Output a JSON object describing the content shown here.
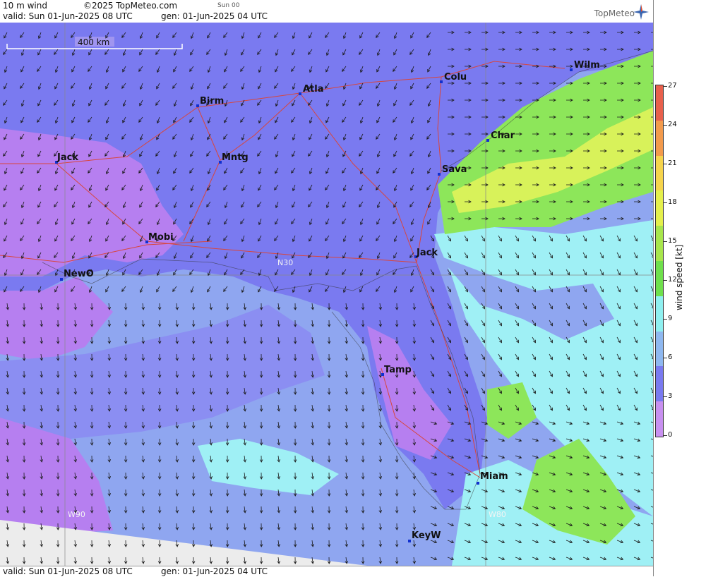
{
  "header": {
    "product": "10 m wind",
    "copyright": "©2025 TopMeteo.com",
    "run_tag": "Sun 00",
    "valid": "valid:  Sun  01-Jun-2025  08 UTC",
    "gen": "gen: 01-Jun-2025 04 UTC",
    "brand": "TopMeteo"
  },
  "footer": {
    "valid": "valid:  Sun  01-Jun-2025  08 UTC",
    "gen": "gen: 01-Jun-2025 04 UTC"
  },
  "scale_bar": {
    "label": "400 km"
  },
  "grid_labels": [
    "N30",
    "W90",
    "W80"
  ],
  "cities": [
    {
      "name": "Wilm"
    },
    {
      "name": "Colu"
    },
    {
      "name": "Atla"
    },
    {
      "name": "Birm"
    },
    {
      "name": "Char"
    },
    {
      "name": "Jack"
    },
    {
      "name": "Mntg"
    },
    {
      "name": "Sava"
    },
    {
      "name": "Mobi"
    },
    {
      "name": "Jack"
    },
    {
      "name": "NewO"
    },
    {
      "name": "Tamp"
    },
    {
      "name": "Miam"
    },
    {
      "name": "KeyW"
    }
  ],
  "colorbar": {
    "title": "wind speed [kt]",
    "ticks": [
      "27",
      "24",
      "21",
      "18",
      "15",
      "12",
      "9",
      "6",
      "3",
      "0"
    ],
    "colors": [
      "#e8604c",
      "#f39a4c",
      "#f6d44c",
      "#e5f04c",
      "#a8e64c",
      "#6fe04c",
      "#8ff0f0",
      "#8fb8f0",
      "#7a7af0",
      "#c890f0"
    ]
  },
  "colors": {
    "land_calm": "#b67ff0",
    "sea_mid": "#8fa6f0",
    "sea_light": "#9ff0f5",
    "wind_green": "#8de65a",
    "wind_yellow": "#d8f25a"
  }
}
